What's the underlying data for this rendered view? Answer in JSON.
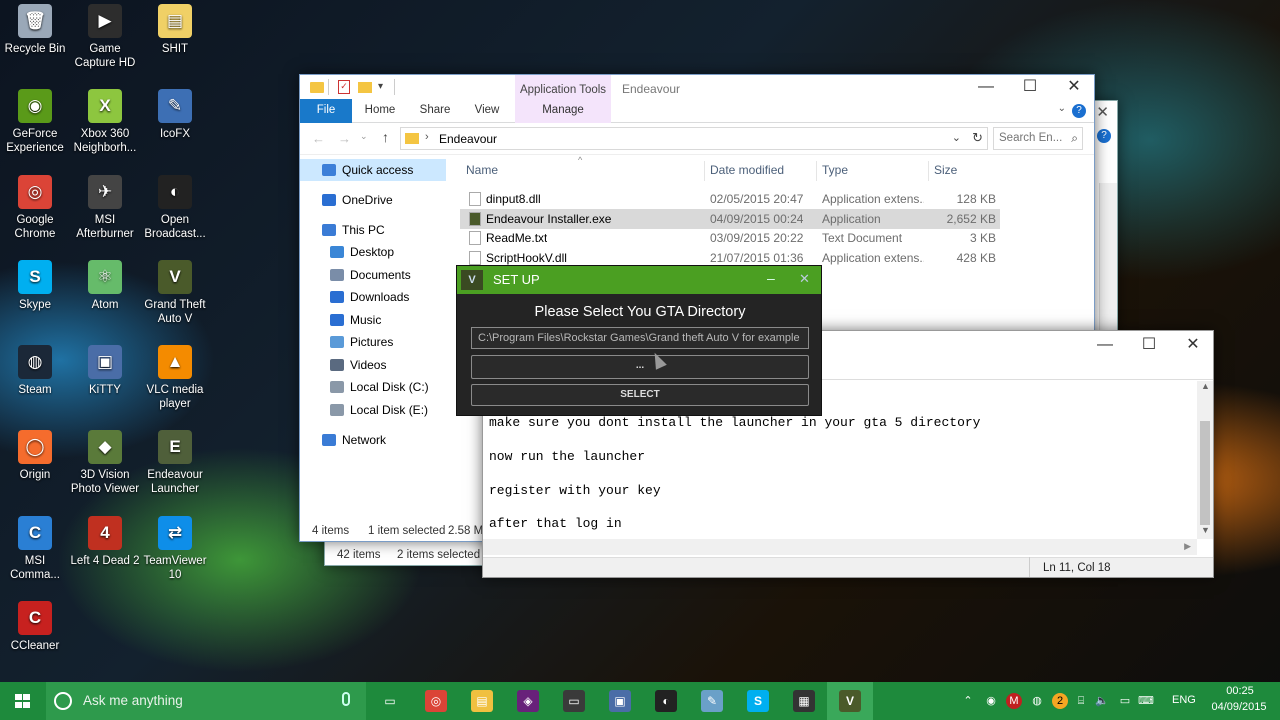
{
  "desktop_icons": [
    {
      "label": "Recycle Bin",
      "icon": "recycle-bin-icon",
      "color": "#9aa8b8",
      "glyph": "🗑"
    },
    {
      "label": "Game\nCapture HD",
      "icon": "game-capture-icon",
      "color": "#2d2d2d",
      "glyph": "▶"
    },
    {
      "label": "SHIT",
      "icon": "folder-icon",
      "color": "#f0d066",
      "glyph": "▤"
    },
    {
      "label": "GeForce\nExperience",
      "icon": "geforce-icon",
      "color": "#5a9a19",
      "glyph": "◉"
    },
    {
      "label": "Xbox 360\nNeighborh...",
      "icon": "xbox-icon",
      "color": "#8dc63f",
      "glyph": "X"
    },
    {
      "label": "IcoFX",
      "icon": "icofx-icon",
      "color": "#3d6fb4",
      "glyph": "✎"
    },
    {
      "label": "Google\nChrome",
      "icon": "chrome-icon",
      "color": "#db4437",
      "glyph": "◎"
    },
    {
      "label": "MSI\nAfterburner",
      "icon": "afterburner-icon",
      "color": "#444",
      "glyph": "✈"
    },
    {
      "label": "Open\nBroadcast...",
      "icon": "obs-icon",
      "color": "#222",
      "glyph": "◐"
    },
    {
      "label": "Skype",
      "icon": "skype-icon",
      "color": "#00aff0",
      "glyph": "S"
    },
    {
      "label": "Atom",
      "icon": "atom-icon",
      "color": "#66bb6a",
      "glyph": "⚛"
    },
    {
      "label": "Grand Theft\nAuto V",
      "icon": "gta-icon",
      "color": "#4a5a2a",
      "glyph": "V"
    },
    {
      "label": "Steam",
      "icon": "steam-icon",
      "color": "#1b2838",
      "glyph": "◍"
    },
    {
      "label": "KiTTY",
      "icon": "kitty-icon",
      "color": "#4a6da7",
      "glyph": "▣"
    },
    {
      "label": "VLC media\nplayer",
      "icon": "vlc-icon",
      "color": "#f48b00",
      "glyph": "▲"
    },
    {
      "label": "Origin",
      "icon": "origin-icon",
      "color": "#f56c2d",
      "glyph": "◯"
    },
    {
      "label": "3D Vision\nPhoto Viewer",
      "icon": "3d-vision-icon",
      "color": "#5a7a3a",
      "glyph": "◆"
    },
    {
      "label": "Endeavour\nLauncher",
      "icon": "endeavour-icon",
      "color": "#4f5f3a",
      "glyph": "E"
    },
    {
      "label": "MSI\nComma...",
      "icon": "msi-command-icon",
      "color": "#2a7fd4",
      "glyph": "C"
    },
    {
      "label": "Left 4 Dead 2",
      "icon": "l4d2-icon",
      "color": "#c03020",
      "glyph": "4"
    },
    {
      "label": "TeamViewer\n10",
      "icon": "teamviewer-icon",
      "color": "#0e8ee9",
      "glyph": "⇄"
    },
    {
      "label": "CCleaner",
      "icon": "ccleaner-icon",
      "color": "#c7211f",
      "glyph": "C"
    }
  ],
  "explorer": {
    "context_tab": "Application Tools",
    "window_title": "Endeavour",
    "tabs": [
      "File",
      "Home",
      "Share",
      "View",
      "Manage"
    ],
    "path": "Endeavour",
    "search_placeholder": "Search En...",
    "sidebar": [
      {
        "label": "Quick access",
        "icon": "quick-access-icon",
        "color": "#3c7fd8"
      },
      {
        "label": "OneDrive",
        "icon": "onedrive-icon",
        "color": "#2a6ed2"
      },
      {
        "label": "This PC",
        "icon": "this-pc-icon",
        "color": "#3a7bd5"
      },
      {
        "label": "Desktop",
        "icon": "desktop-icon",
        "color": "#3a86d6"
      },
      {
        "label": "Documents",
        "icon": "documents-icon",
        "color": "#7a8da8"
      },
      {
        "label": "Downloads",
        "icon": "downloads-icon",
        "color": "#2a6ed2"
      },
      {
        "label": "Music",
        "icon": "music-icon",
        "color": "#2a6ed2"
      },
      {
        "label": "Pictures",
        "icon": "pictures-icon",
        "color": "#5a9ad8"
      },
      {
        "label": "Videos",
        "icon": "videos-icon",
        "color": "#5a6a80"
      },
      {
        "label": "Local Disk (C:)",
        "icon": "disk-icon",
        "color": "#8a98a8"
      },
      {
        "label": "Local Disk (E:)",
        "icon": "disk-icon",
        "color": "#8a98a8"
      },
      {
        "label": "Network",
        "icon": "network-icon",
        "color": "#3a7bd5"
      }
    ],
    "columns": [
      "Name",
      "Date modified",
      "Type",
      "Size"
    ],
    "files": [
      {
        "name": "dinput8.dll",
        "date": "02/05/2015 20:47",
        "type": "Application extens...",
        "size": "128 KB"
      },
      {
        "name": "Endeavour Installer.exe",
        "date": "04/09/2015 00:24",
        "type": "Application",
        "size": "2,652 KB"
      },
      {
        "name": "ReadMe.txt",
        "date": "03/09/2015 20:22",
        "type": "Text Document",
        "size": "3 KB"
      },
      {
        "name": "ScriptHookV.dll",
        "date": "21/07/2015 01:36",
        "type": "Application extens...",
        "size": "428 KB"
      }
    ],
    "status_items": "4 items",
    "status_selected": "1 item selected",
    "status_size": "2.58 MB"
  },
  "explorer_back": {
    "status_items": "42 items",
    "status_selected": "2 items selected"
  },
  "notepad": {
    "lines": [
      "make sure you dont install the launcher in your gta 5 directory",
      "now run the launcher",
      "register with your key",
      "after that log in"
    ],
    "status": "Ln 11, Col 18"
  },
  "setup": {
    "title": "SET UP",
    "heading": "Please Select You GTA Directory",
    "path_value": "C:\\Program Files\\Rockstar Games\\Grand theft Auto V for example",
    "browse_label": "...",
    "select_label": "SELECT",
    "title_color": "#4b9f22"
  },
  "taskbar": {
    "search_placeholder": "Ask me anything",
    "lang": "ENG",
    "time": "00:25",
    "date": "04/09/2015",
    "apps": [
      {
        "icon": "task-view-icon",
        "color": "transparent",
        "glyph": "▭"
      },
      {
        "icon": "chrome-icon",
        "color": "#db4437",
        "glyph": "◎"
      },
      {
        "icon": "file-explorer-icon",
        "color": "#f0c040",
        "glyph": "▤"
      },
      {
        "icon": "visual-studio-icon",
        "color": "#68217a",
        "glyph": "◈"
      },
      {
        "icon": "window-icon",
        "color": "#3a3a3a",
        "glyph": "▭"
      },
      {
        "icon": "network-app-icon",
        "color": "#4a6da7",
        "glyph": "▣"
      },
      {
        "icon": "obs-icon",
        "color": "#222",
        "glyph": "◐"
      },
      {
        "icon": "notepad-icon",
        "color": "#6aa0c8",
        "glyph": "✎"
      },
      {
        "icon": "skype-icon",
        "color": "#00aff0",
        "glyph": "S"
      },
      {
        "icon": "film-icon",
        "color": "#333",
        "glyph": "▦"
      },
      {
        "icon": "gta-icon",
        "color": "#4a5a2a",
        "glyph": "V"
      }
    ]
  }
}
